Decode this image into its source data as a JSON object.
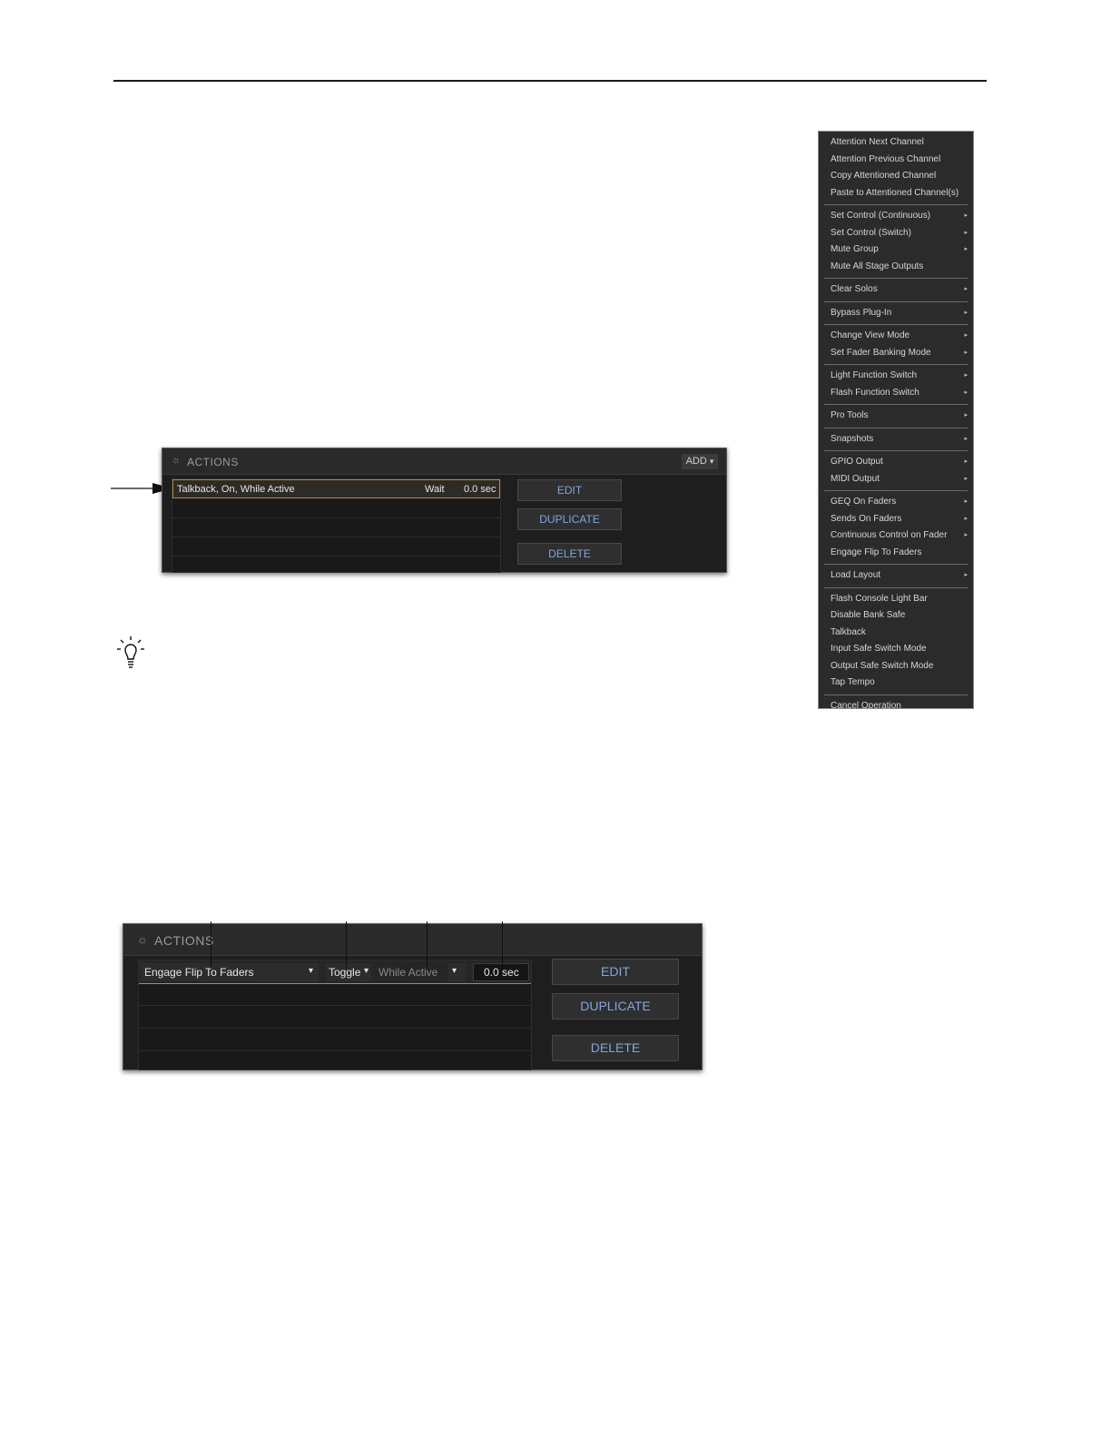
{
  "menu": {
    "groups": [
      [
        {
          "label": "Attention Next Channel",
          "submenu": false
        },
        {
          "label": "Attention Previous Channel",
          "submenu": false
        },
        {
          "label": "Copy Attentioned Channel",
          "submenu": false
        },
        {
          "label": "Paste to Attentioned Channel(s)",
          "submenu": false
        }
      ],
      [
        {
          "label": "Set Control (Continuous)",
          "submenu": true
        },
        {
          "label": "Set Control (Switch)",
          "submenu": true
        },
        {
          "label": "Mute Group",
          "submenu": true
        },
        {
          "label": "Mute All Stage Outputs",
          "submenu": false
        }
      ],
      [
        {
          "label": "Clear Solos",
          "submenu": true
        }
      ],
      [
        {
          "label": "Bypass Plug-In",
          "submenu": true
        }
      ],
      [
        {
          "label": "Change View Mode",
          "submenu": true
        },
        {
          "label": "Set Fader Banking Mode",
          "submenu": true
        }
      ],
      [
        {
          "label": "Light Function Switch",
          "submenu": true
        },
        {
          "label": "Flash Function Switch",
          "submenu": true
        }
      ],
      [
        {
          "label": "Pro Tools",
          "submenu": true
        }
      ],
      [
        {
          "label": "Snapshots",
          "submenu": true
        }
      ],
      [
        {
          "label": "GPIO Output",
          "submenu": true
        },
        {
          "label": "MIDI Output",
          "submenu": true
        }
      ],
      [
        {
          "label": "GEQ On Faders",
          "submenu": true
        },
        {
          "label": "Sends On Faders",
          "submenu": true
        },
        {
          "label": "Continuous Control on Fader",
          "submenu": true
        },
        {
          "label": "Engage Flip To Faders",
          "submenu": false
        }
      ],
      [
        {
          "label": "Load Layout",
          "submenu": true
        }
      ],
      [
        {
          "label": "Flash Console Light Bar",
          "submenu": false
        },
        {
          "label": "Disable Bank Safe",
          "submenu": false
        },
        {
          "label": "Talkback",
          "submenu": false
        },
        {
          "label": "Input Safe Switch Mode",
          "submenu": false
        },
        {
          "label": "Output Safe Switch Mode",
          "submenu": false
        },
        {
          "label": "Tap Tempo",
          "submenu": false
        }
      ],
      [
        {
          "label": "Cancel Operation",
          "submenu": false
        }
      ]
    ],
    "submenu_glyph": "▸"
  },
  "panel1": {
    "title": "ACTIONS",
    "add_label": "ADD",
    "add_glyph": "▾",
    "row": {
      "action": "Talkback, On, While Active",
      "wait_label": "Wait",
      "wait_value": "0.0 sec"
    },
    "buttons": {
      "edit": "EDIT",
      "duplicate": "DUPLICATE",
      "delete": "DELETE"
    }
  },
  "panel2": {
    "title": "ACTIONS",
    "row": {
      "action": "Engage Flip To Faders",
      "mode": "Toggle",
      "timing": "While Active",
      "delay": "0.0 sec"
    },
    "buttons": {
      "edit": "EDIT",
      "duplicate": "DUPLICATE",
      "delete": "DELETE"
    }
  },
  "icons": {
    "bulb": "lightbulb-icon",
    "arrow": "callout-arrow-icon",
    "dropdown": "chevron-down-icon"
  },
  "colors": {
    "accent_text": "#7fa7dd",
    "selection_border": "#b78a3f",
    "panel_bg": "#1e1e1e"
  }
}
